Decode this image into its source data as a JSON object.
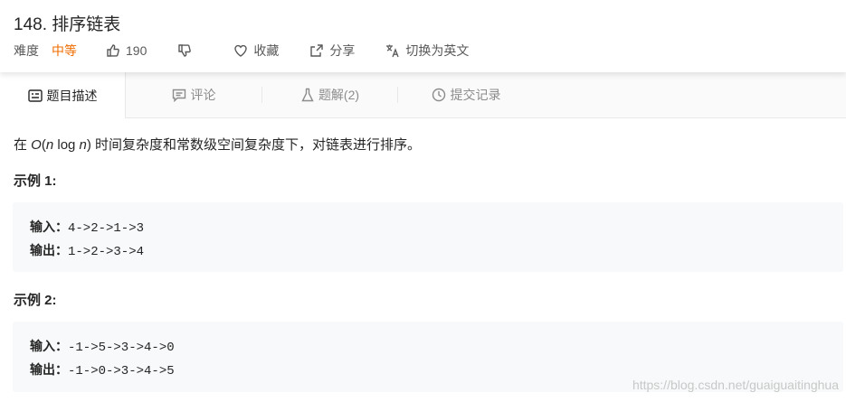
{
  "problem": {
    "title": "148. 排序链表",
    "difficulty_label": "难度",
    "difficulty_value": "中等",
    "likes": "190",
    "favorite_label": "收藏",
    "share_label": "分享",
    "switch_lang_label": "切换为英文"
  },
  "tabs": [
    {
      "label": "题目描述",
      "icon": "description-icon",
      "active": true
    },
    {
      "label": "评论",
      "icon": "comment-icon",
      "active": false
    },
    {
      "label": "题解(2)",
      "icon": "flask-icon",
      "active": false
    },
    {
      "label": "提交记录",
      "icon": "clock-icon",
      "active": false
    }
  ],
  "description": {
    "pre": "在 ",
    "o": "O",
    "paren_open": "(",
    "n1": "n",
    "log": " log ",
    "n2": "n",
    "paren_close": ")",
    "post": " 时间复杂度和常数级空间复杂度下，对链表进行排序。"
  },
  "examples": [
    {
      "title": "示例 1:",
      "input_label": "输入：",
      "input": "4->2->1->3",
      "output_label": "输出：",
      "output": "1->2->3->4"
    },
    {
      "title": "示例 2:",
      "input_label": "输入：",
      "input": "-1->5->3->4->0",
      "output_label": "输出：",
      "output": "-1->0->3->4->5"
    }
  ],
  "watermark": "https://blog.csdn.net/guaiguaitinghua"
}
